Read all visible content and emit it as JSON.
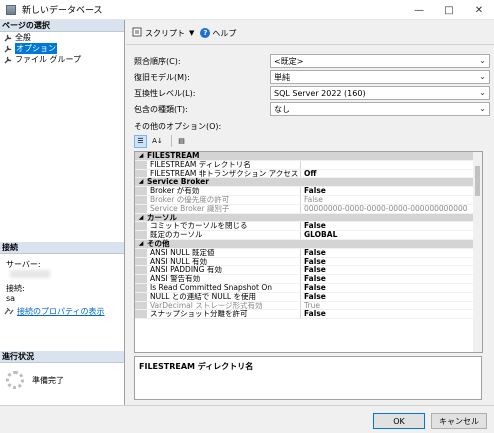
{
  "window": {
    "title": "新しいデータベース"
  },
  "left": {
    "page_select_header": "ページの選択",
    "pages": [
      {
        "label": "全般"
      },
      {
        "label": "オプション"
      },
      {
        "label": "ファイル グループ"
      }
    ],
    "connection_header": "接続",
    "server_label": "サーバー:",
    "connection_label": "接続:",
    "connection_value": "sa",
    "connection_props_link": "接続のプロパティの表示",
    "progress_header": "進行状況",
    "progress_status": "準備完了"
  },
  "toolbar": {
    "script_label": "スクリプト",
    "help_label": "ヘルプ"
  },
  "form": {
    "collation_label": "照合順序(C):",
    "collation_value": "<既定>",
    "recovery_label": "復旧モデル(M):",
    "recovery_value": "単純",
    "compat_label": "互換性レベル(L):",
    "compat_value": "SQL Server 2022 (160)",
    "containment_label": "包含の種類(T):",
    "containment_value": "なし",
    "other_options_label": "その他のオプション(O):"
  },
  "grid": {
    "rows": [
      {
        "type": "cat",
        "name": "FILESTREAM"
      },
      {
        "type": "prop",
        "name": "FILESTREAM ディレクトリ名",
        "value": ""
      },
      {
        "type": "prop",
        "name": "FILESTREAM 非トランザクション アクセス",
        "value": "Off"
      },
      {
        "type": "cat",
        "name": "Service Broker"
      },
      {
        "type": "prop",
        "name": "Broker が有効",
        "value": "False"
      },
      {
        "type": "disabled",
        "name": "Broker の優先度の許可",
        "value": "False"
      },
      {
        "type": "disabled",
        "name": "Service Broker 識別子",
        "value": "00000000-0000-0000-0000-000000000000"
      },
      {
        "type": "cat",
        "name": "カーソル"
      },
      {
        "type": "prop",
        "name": "コミットでカーソルを閉じる",
        "value": "False"
      },
      {
        "type": "prop",
        "name": "既定のカーソル",
        "value": "GLOBAL"
      },
      {
        "type": "cat",
        "name": "その他"
      },
      {
        "type": "prop",
        "name": "ANSI NULL 既定値",
        "value": "False"
      },
      {
        "type": "prop",
        "name": "ANSI NULL 有効",
        "value": "False"
      },
      {
        "type": "prop",
        "name": "ANSI PADDING 有効",
        "value": "False"
      },
      {
        "type": "prop",
        "name": "ANSI 警告有効",
        "value": "False"
      },
      {
        "type": "prop",
        "name": "Is Read Committed Snapshot On",
        "value": "False"
      },
      {
        "type": "prop",
        "name": "NULL との連結で NULL を使用",
        "value": "False"
      },
      {
        "type": "disabled",
        "name": "VarDecimal ストレージ形式有効",
        "value": "True"
      },
      {
        "type": "prop",
        "name": "スナップショット分離を許可",
        "value": "False"
      }
    ]
  },
  "description": "FILESTREAM ディレクトリ名",
  "buttons": {
    "ok": "OK",
    "cancel": "キャンセル"
  }
}
